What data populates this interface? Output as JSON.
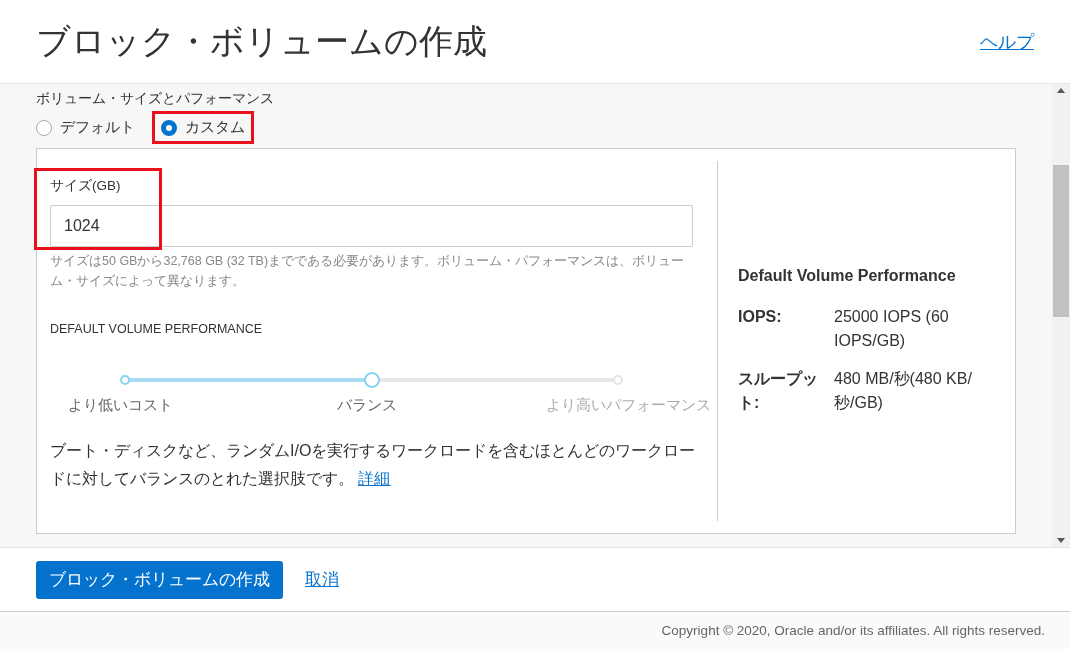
{
  "header": {
    "title": "ブロック・ボリュームの作成",
    "help_link": "ヘルプ"
  },
  "section": {
    "label": "ボリューム・サイズとパフォーマンス",
    "options": [
      {
        "label": "デフォルト",
        "selected": false,
        "highlighted": false
      },
      {
        "label": "カスタム",
        "selected": true,
        "highlighted": true
      }
    ]
  },
  "size_field": {
    "label": "サイズ(GB)",
    "value": "1024",
    "highlighted": true,
    "hint": "サイズは50 GBから32,768 GB (32 TB)までである必要があります。ボリューム・パフォーマンスは、ボリューム・サイズによって異なります。"
  },
  "performance": {
    "label": "DEFAULT VOLUME PERFORMANCE",
    "level": 0.5,
    "stops": [
      {
        "label": "より低いコスト",
        "selected": false
      },
      {
        "label": "バランス",
        "selected": true
      },
      {
        "label": "より高いパフォーマンス",
        "selected": false
      }
    ],
    "description": "ブート・ディスクなど、ランダムI/Oを実行するワークロードを含むほとんどのワークロードに対してバランスのとれた選択肢です。",
    "details_link": "詳細"
  },
  "summary": {
    "title": "Default Volume Performance",
    "rows": [
      {
        "label": "IOPS:",
        "value": "25000 IOPS (60 IOPS/GB)"
      },
      {
        "label": "スループット:",
        "value": "480 MB/秒(480 KB/秒/GB)"
      }
    ]
  },
  "footer": {
    "create_button": "ブロック・ボリュームの作成",
    "cancel_link": "取消"
  },
  "copyright": "Copyright © 2020, Oracle and/or its affiliates. All rights reserved."
}
